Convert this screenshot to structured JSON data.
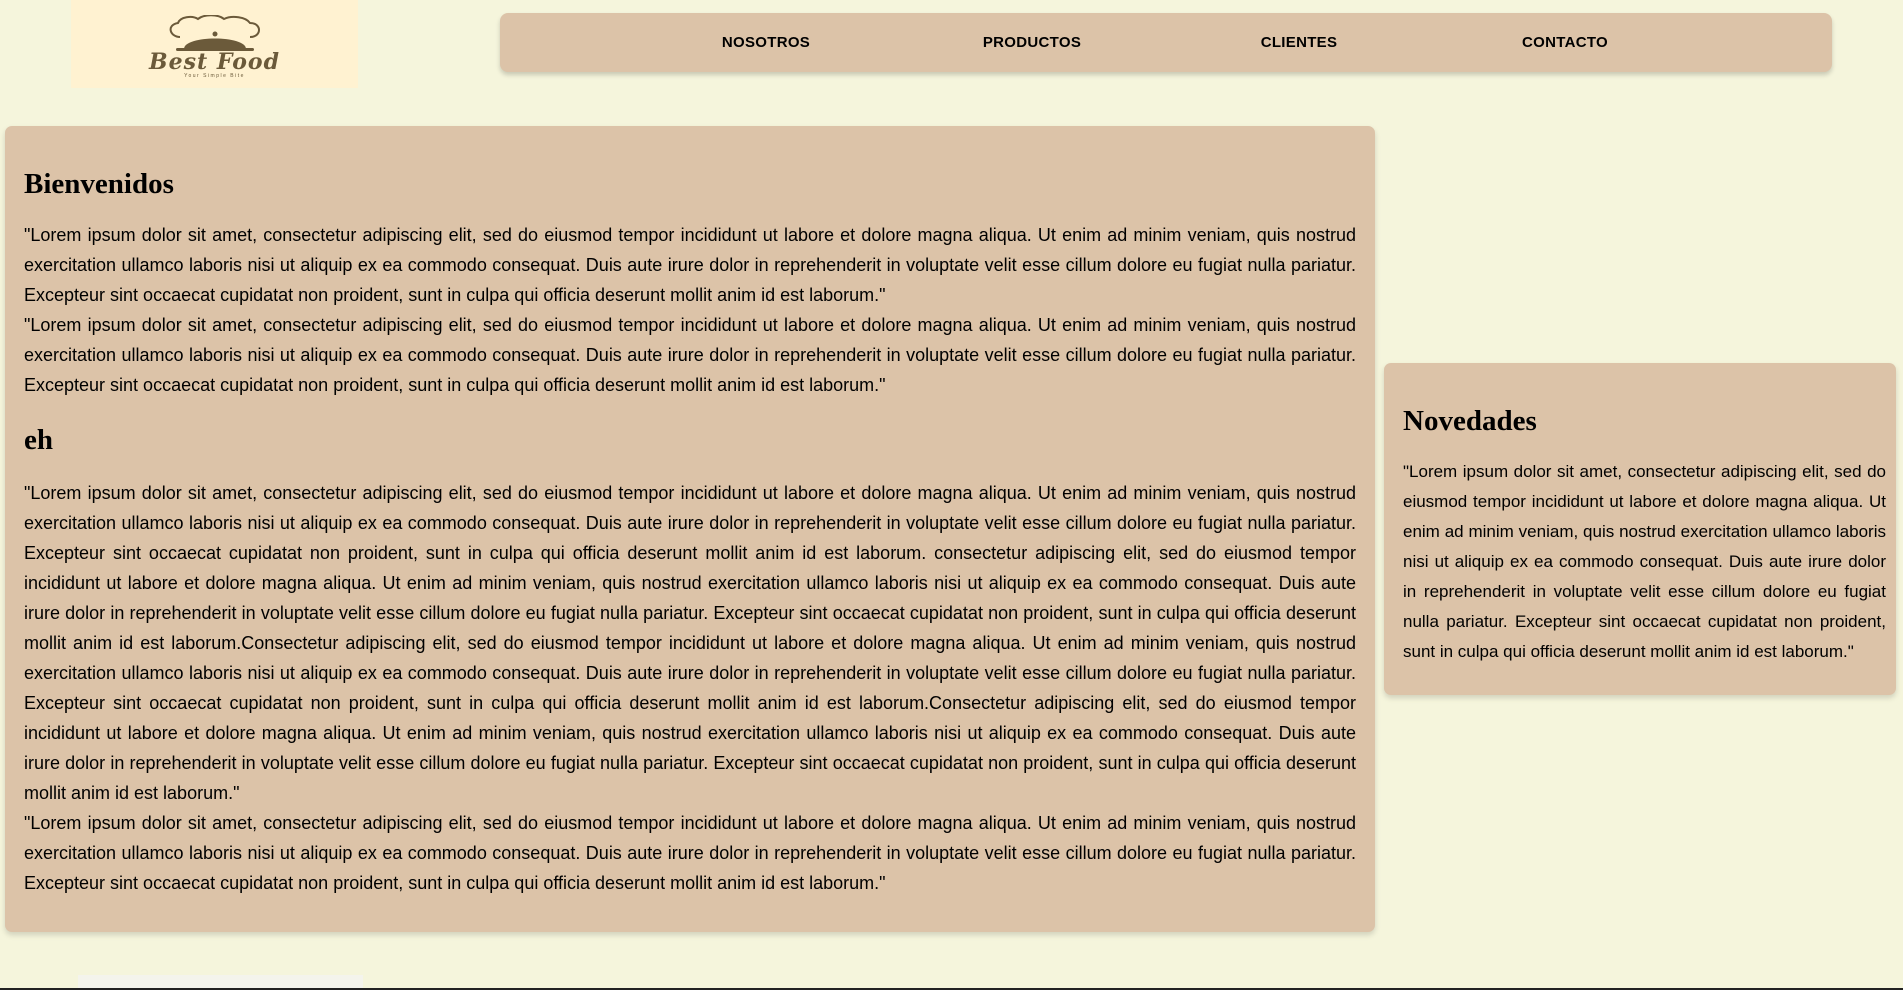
{
  "logo": {
    "brand": "Best Food",
    "tagline": "Your Simple Bite",
    "icon": "cloche-chef-hat-icon",
    "background": "#fff2d1",
    "ink": "#6b5a3a"
  },
  "nav": {
    "items": [
      {
        "label": "NOSOTROS"
      },
      {
        "label": "PRODUCTOS"
      },
      {
        "label": "CLIENTES"
      },
      {
        "label": "CONTACTO"
      }
    ]
  },
  "main": {
    "title": "Bienvenidos",
    "paragraphs": [
      "\"Lorem ipsum dolor sit amet, consectetur adipiscing elit, sed do eiusmod tempor incididunt ut labore et dolore magna aliqua. Ut enim ad minim veniam, quis nostrud exercitation ullamco laboris nisi ut aliquip ex ea commodo consequat. Duis aute irure dolor in reprehenderit in voluptate velit esse cillum dolore eu fugiat nulla pariatur. Excepteur sint occaecat cupidatat non proident, sunt in culpa qui officia deserunt mollit anim id est laborum.\"",
      "\"Lorem ipsum dolor sit amet, consectetur adipiscing elit, sed do eiusmod tempor incididunt ut labore et dolore magna aliqua. Ut enim ad minim veniam, quis nostrud exercitation ullamco laboris nisi ut aliquip ex ea commodo consequat. Duis aute irure dolor in reprehenderit in voluptate velit esse cillum dolore eu fugiat nulla pariatur. Excepteur sint occaecat cupidatat non proident, sunt in culpa qui officia deserunt mollit anim id est laborum.\""
    ],
    "section2_title": "eh",
    "section2_paragraphs": [
      "\"Lorem ipsum dolor sit amet, consectetur adipiscing elit, sed do eiusmod tempor incididunt ut labore et dolore magna aliqua. Ut enim ad minim veniam, quis nostrud exercitation ullamco laboris nisi ut aliquip ex ea commodo consequat. Duis aute irure dolor in reprehenderit in voluptate velit esse cillum dolore eu fugiat nulla pariatur. Excepteur sint occaecat cupidatat non proident, sunt in culpa qui officia deserunt mollit anim id est laborum. consectetur adipiscing elit, sed do eiusmod tempor incididunt ut labore et dolore magna aliqua. Ut enim ad minim veniam, quis nostrud exercitation ullamco laboris nisi ut aliquip ex ea commodo consequat. Duis aute irure dolor in reprehenderit in voluptate velit esse cillum dolore eu fugiat nulla pariatur. Excepteur sint occaecat cupidatat non proident, sunt in culpa qui officia deserunt mollit anim id est laborum.Consectetur adipiscing elit, sed do eiusmod tempor incididunt ut labore et dolore magna aliqua. Ut enim ad minim veniam, quis nostrud exercitation ullamco laboris nisi ut aliquip ex ea commodo consequat. Duis aute irure dolor in reprehenderit in voluptate velit esse cillum dolore eu fugiat nulla pariatur. Excepteur sint occaecat cupidatat non proident, sunt in culpa qui officia deserunt mollit anim id est laborum.Consectetur adipiscing elit, sed do eiusmod tempor incididunt ut labore et dolore magna aliqua. Ut enim ad minim veniam, quis nostrud exercitation ullamco laboris nisi ut aliquip ex ea commodo consequat. Duis aute irure dolor in reprehenderit in voluptate velit esse cillum dolore eu fugiat nulla pariatur. Excepteur sint occaecat cupidatat non proident, sunt in culpa qui officia deserunt mollit anim id est laborum.\"",
      "\"Lorem ipsum dolor sit amet, consectetur adipiscing elit, sed do eiusmod tempor incididunt ut labore et dolore magna aliqua. Ut enim ad minim veniam, quis nostrud exercitation ullamco laboris nisi ut aliquip ex ea commodo consequat. Duis aute irure dolor in reprehenderit in voluptate velit esse cillum dolore eu fugiat nulla pariatur. Excepteur sint occaecat cupidatat non proident, sunt in culpa qui officia deserunt mollit anim id est laborum.\""
    ]
  },
  "aside": {
    "title": "Novedades",
    "paragraph": "\"Lorem ipsum dolor sit amet, consectetur adipiscing elit, sed do eiusmod tempor incididunt ut labore et dolore magna aliqua. Ut enim ad minim veniam, quis nostrud exercitation ullamco laboris nisi ut aliquip ex ea commodo consequat. Duis aute irure dolor in reprehenderit in voluptate velit esse cillum dolore eu fugiat nulla pariatur. Excepteur sint occaecat cupidatat non proident, sunt in culpa qui officia deserunt mollit anim id est laborum.\""
  },
  "colors": {
    "page_background": "#f5f5dc",
    "panel": "#dcc3a8",
    "text": "#000000"
  }
}
